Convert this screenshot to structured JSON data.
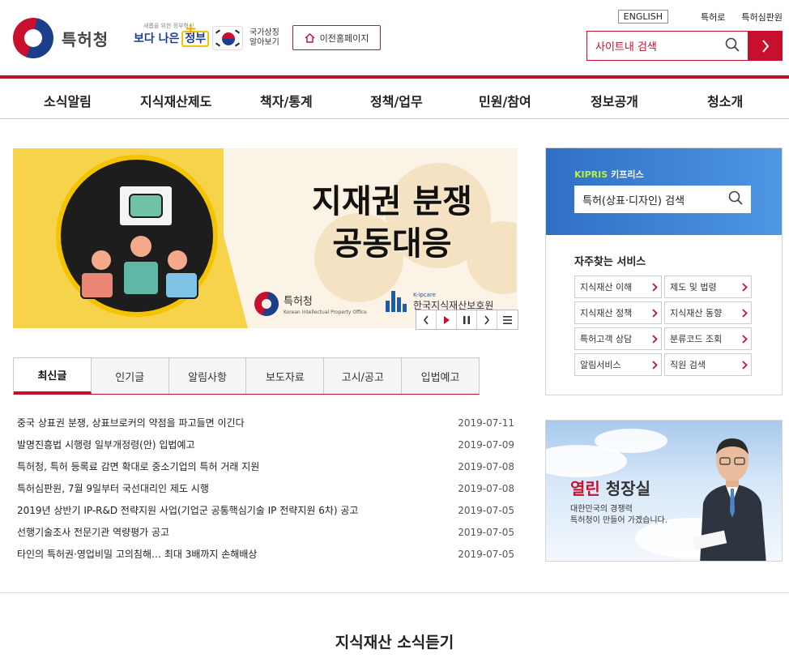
{
  "header": {
    "logo_text": "특허청",
    "gov_slogan_small": "새롭을 위한 정부혁신",
    "gov_slogan_main": "보다 나은",
    "gov_slogan_highlight": "정부",
    "symbol_text_1": "국가상징",
    "symbol_text_2": "알아보기",
    "old_home_label": "이전홈페이지",
    "top_links": {
      "english": "ENGLISH",
      "link1": "특허로",
      "link2": "특허심판원"
    },
    "search": {
      "placeholder": "사이트내 검색"
    }
  },
  "nav": [
    "소식알림",
    "지식재산제도",
    "책자/통계",
    "정책/업무",
    "민원/참여",
    "정보공개",
    "청소개"
  ],
  "banner": {
    "title_line1": "지재권 분쟁",
    "title_line2": "공동대응",
    "org1": "특허청",
    "org1_en": "Korean Intellectual Property Office",
    "org2_small": "K-ipcare",
    "org2": "한국지식재산보호원"
  },
  "tabs": [
    "최신글",
    "인기글",
    "알림사항",
    "보도자료",
    "고시/공고",
    "입법예고"
  ],
  "active_tab": "최신글",
  "news": [
    {
      "title": "중국 상표권 분쟁, 상표브로커의 약점을 파고들면 이긴다",
      "date": "2019-07-11"
    },
    {
      "title": "발명진흥법 시행령 일부개정령(안) 입법예고",
      "date": "2019-07-09"
    },
    {
      "title": "특허청, 특허 등록료 감면 확대로 중소기업의 특허 거래 지원",
      "date": "2019-07-08"
    },
    {
      "title": "특허심판원, 7월 9일부터 국선대리인 제도 시행",
      "date": "2019-07-08"
    },
    {
      "title": "2019년 상반기 IP-R&D 전략지원 사업(기업군 공통핵심기술 IP 전략지원 6차) 공고",
      "date": "2019-07-05"
    },
    {
      "title": "선행기술조사 전문기관 역량평가 공고",
      "date": "2019-07-05"
    },
    {
      "title": "타인의 특허권·영업비밀 고의침해… 최대 3배까지 손해배상",
      "date": "2019-07-05"
    }
  ],
  "kipris": {
    "brand": "KIPRIS",
    "label": "키프리스",
    "search_text": "특허(상표·디자인) 검색",
    "fav_title": "자주찾는 서비스",
    "services": [
      "지식재산 이해",
      "제도 및 법령",
      "지식재산 정책",
      "지식재산 동향",
      "특허고객 상담",
      "분류코드 조회",
      "알림서비스",
      "직원 검색"
    ]
  },
  "commissioner": {
    "title_red": "열린",
    "title": "청장실",
    "sub1": "대한민국의 경쟁력",
    "sub2": "특허청이 만들어 가겠습니다."
  },
  "section_title": "지식재산 소식듣기",
  "colors": {
    "brand_red": "#c8102e",
    "brand_blue": "#1b3f8b",
    "kipris_blue": "#2f6fc4",
    "banner_yellow": "#f7d24b"
  }
}
